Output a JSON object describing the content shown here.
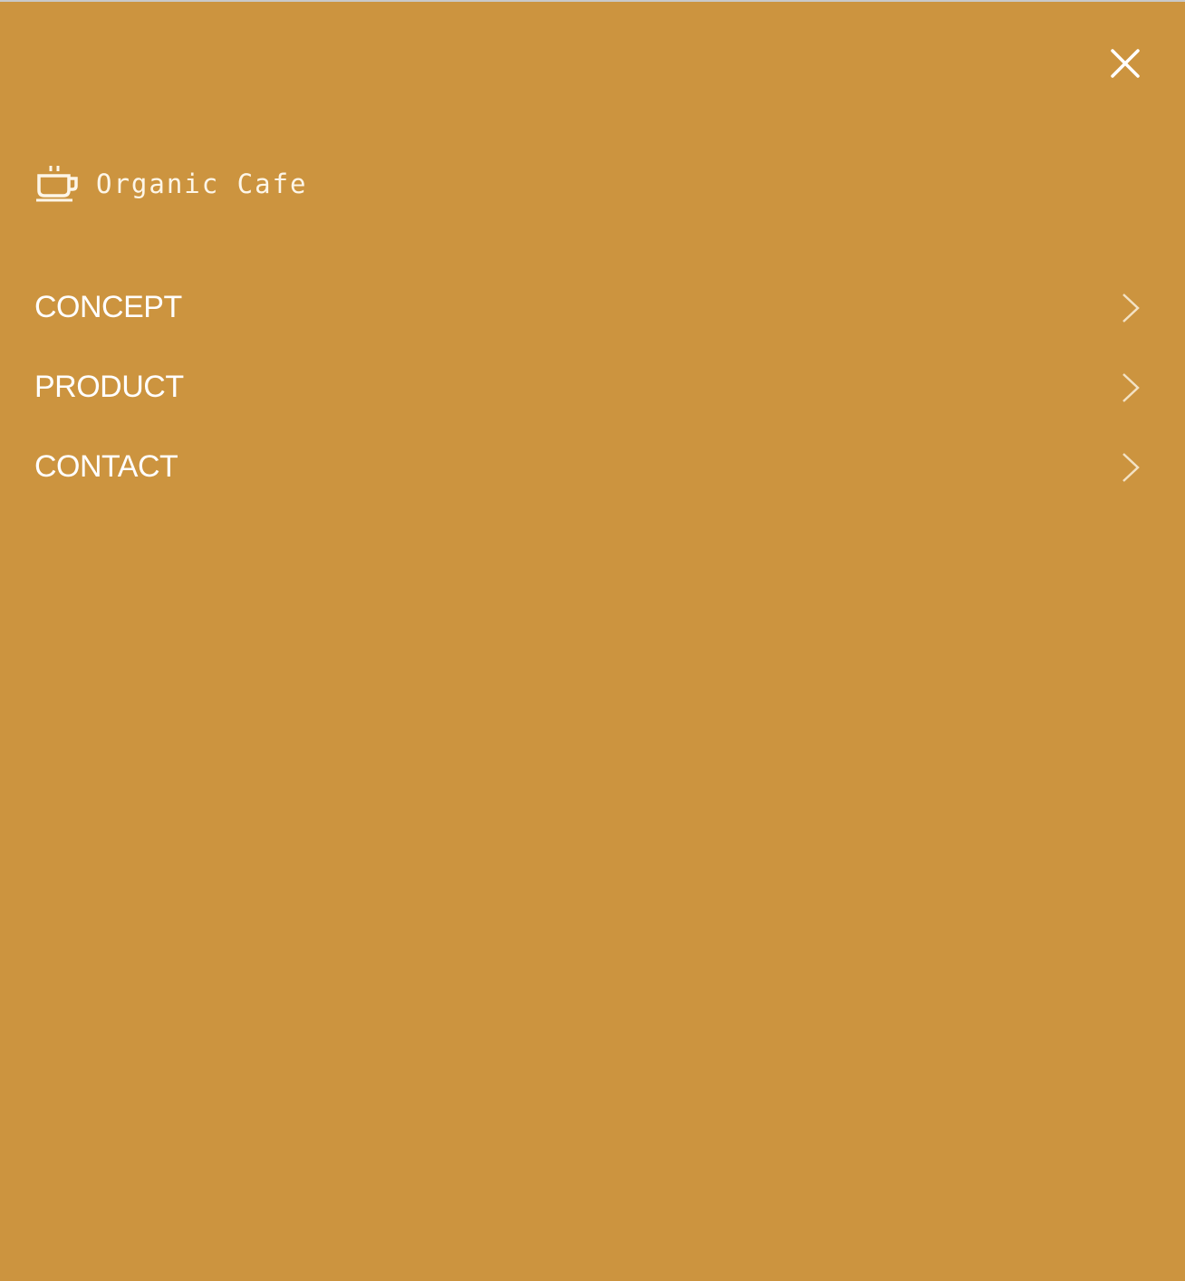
{
  "header": {
    "close_icon": "close-icon"
  },
  "logo": {
    "icon": "coffee-cup-icon",
    "text": "Organic Cafe"
  },
  "menu": {
    "items": [
      {
        "label": "CONCEPT",
        "icon": "chevron-right-icon"
      },
      {
        "label": "PRODUCT",
        "icon": "chevron-right-icon"
      },
      {
        "label": "CONTACT",
        "icon": "chevron-right-icon"
      }
    ]
  },
  "colors": {
    "background": "#cc943f",
    "foreground": "#ffffff"
  }
}
